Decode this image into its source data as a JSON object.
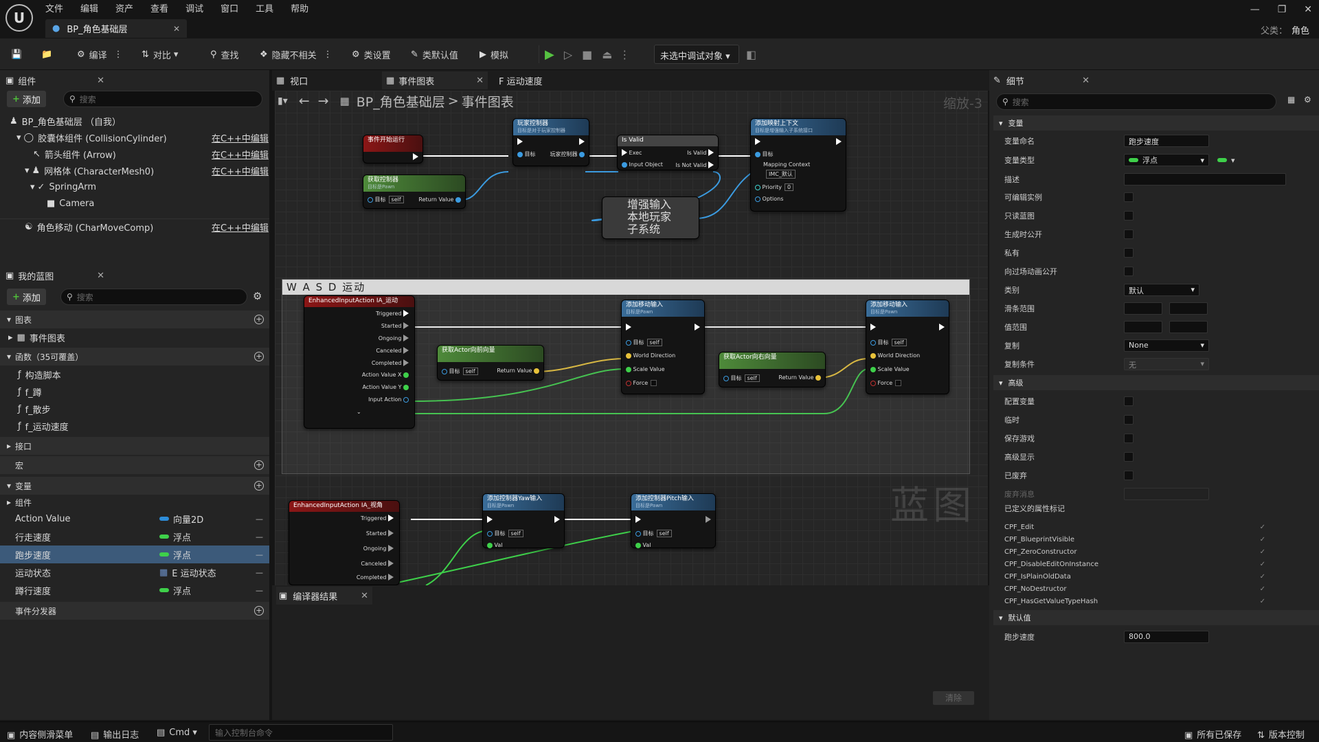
{
  "menu": [
    "文件",
    "编辑",
    "资产",
    "查看",
    "调试",
    "窗口",
    "工具",
    "帮助"
  ],
  "document_tab": "BP_角色基础层",
  "parent": {
    "label": "父类：",
    "value": "角色"
  },
  "toolbar": {
    "compile": "编译",
    "diff": "对比",
    "find": "查找",
    "hide_unrelated": "隐藏不相关",
    "class_settings": "类设置",
    "class_defaults": "类默认值",
    "simulate": "模拟",
    "debug_target": "未选中调试对象"
  },
  "components": {
    "tab": "组件",
    "add": "添加",
    "search_placeholder": "搜索",
    "rows": [
      {
        "label": "BP_角色基础层 （自我）",
        "edit": ""
      },
      {
        "label": "胶囊体组件 (CollisionCylinder)",
        "edit": "在C++中编辑"
      },
      {
        "label": "箭头组件 (Arrow)",
        "edit": "在C++中编辑"
      },
      {
        "label": "网格体 (CharacterMesh0)",
        "edit": "在C++中编辑"
      },
      {
        "label": "SpringArm",
        "edit": ""
      },
      {
        "label": "Camera",
        "edit": ""
      },
      {
        "label": "角色移动 (CharMoveComp)",
        "edit": "在C++中编辑"
      }
    ]
  },
  "my_blueprint": {
    "tab": "我的蓝图",
    "add": "添加",
    "search_placeholder": "搜索",
    "graphs_hdr": "图表",
    "event_graph": "事件图表",
    "functions_hdr": "函数（35可覆盖）",
    "functions": [
      "构造脚本",
      "f_蹲",
      "f_散步",
      "f_运动速度"
    ],
    "interfaces_hdr": "接口",
    "macros_hdr": "宏",
    "variables_hdr": "变量",
    "components_group": "组件",
    "variables": [
      {
        "name": "Action Value",
        "type": "向量2D",
        "color": "#2d8cd8"
      },
      {
        "name": "行走速度",
        "type": "浮点",
        "color": "#3ed04a"
      },
      {
        "name": "跑步速度",
        "type": "浮点",
        "color": "#3ed04a"
      },
      {
        "name": "运动状态",
        "type": "E 运动状态",
        "color": "#3a5a8a"
      },
      {
        "name": "蹲行速度",
        "type": "浮点",
        "color": "#3ed04a"
      }
    ],
    "dispatchers_hdr": "事件分发器"
  },
  "graph": {
    "tabs": [
      "视口",
      "事件图表",
      "F 运动速度"
    ],
    "breadcrumb": [
      "BP_角色基础层",
      "事件图表"
    ],
    "zoom": "缩放-3",
    "comment": "W A S D 运动",
    "watermark": "蓝图",
    "nodes": {
      "begin_play": "事件开始运行",
      "get_controller": "获取控制器",
      "get_controller_sub": "目标是Pawn",
      "cast": "玩家控制器",
      "cast_sub": "目标是对于玩家控制器",
      "is_valid": "Is Valid",
      "subsystem": "增强输入\n本地玩家\n子系统",
      "add_mapping": "添加映射上下文",
      "add_mapping_sub": "目标是增强输入子系统接口",
      "ia_move": "EnhancedInputAction IA_运动",
      "get_forward": "获取Actor向前向量",
      "get_right": "获取Actor向右向量",
      "add_move": "添加移动输入",
      "add_move_sub": "目标是Pawn",
      "ia_look": "EnhancedInputAction IA_视角",
      "add_yaw": "添加控制器Yaw输入",
      "add_pitch": "添加控制器Pitch输入"
    },
    "pins": {
      "target": "目标",
      "self": "self",
      "return_value": "Return Value",
      "exec": "Exec",
      "is_valid": "Is Valid",
      "is_not_valid": "Is Not Valid",
      "input_object": "Input Object",
      "player_controller": "玩家控制器",
      "mapping_context": "Mapping Context",
      "imc_default": "IMC_默认",
      "priority": "Priority",
      "priority_val": "0",
      "options": "Options",
      "triggered": "Triggered",
      "started": "Started",
      "ongoing": "Ongoing",
      "canceled": "Canceled",
      "completed": "Completed",
      "action_x": "Action Value X",
      "action_y": "Action Value Y",
      "input_action": "Input Action",
      "world_direction": "World Direction",
      "scale_value": "Scale Value",
      "force": "Force",
      "val": "Val"
    }
  },
  "compiler": {
    "tab": "编译器结果",
    "clear": "清除"
  },
  "details": {
    "tab": "细节",
    "search_placeholder": "搜索",
    "variable_hdr": "变量",
    "var_name_label": "变量命名",
    "var_name": "跑步速度",
    "var_type_label": "变量类型",
    "var_type": "浮点",
    "desc_label": "描述",
    "checks1": [
      "可编辑实例",
      "只读蓝图",
      "生成时公开",
      "私有",
      "向过场动画公开"
    ],
    "category_label": "类别",
    "category": "默认",
    "slider_label": "滑条范围",
    "value_range_label": "值范围",
    "replication_label": "复制",
    "replication": "None",
    "rep_cond_label": "复制条件",
    "rep_cond": "无",
    "advanced_hdr": "高级",
    "checks2": [
      "配置变量",
      "临时",
      "保存游戏",
      "高级显示",
      "已废弃"
    ],
    "deprecation_label": "废弃消息",
    "flags_label": "已定义的属性标记",
    "flags": [
      "CPF_Edit",
      "CPF_BlueprintVisible",
      "CPF_ZeroConstructor",
      "CPF_DisableEditOnInstance",
      "CPF_IsPlainOldData",
      "CPF_NoDestructor",
      "CPF_HasGetValueTypeHash"
    ],
    "default_hdr": "默认值",
    "default_label": "跑步速度",
    "default_value": "800.0"
  },
  "status": {
    "content_drawer": "内容侧滑菜单",
    "output_log": "输出日志",
    "cmd": "Cmd",
    "console_placeholder": "输入控制台命令",
    "all_saved": "所有已保存",
    "source_control": "版本控制"
  }
}
